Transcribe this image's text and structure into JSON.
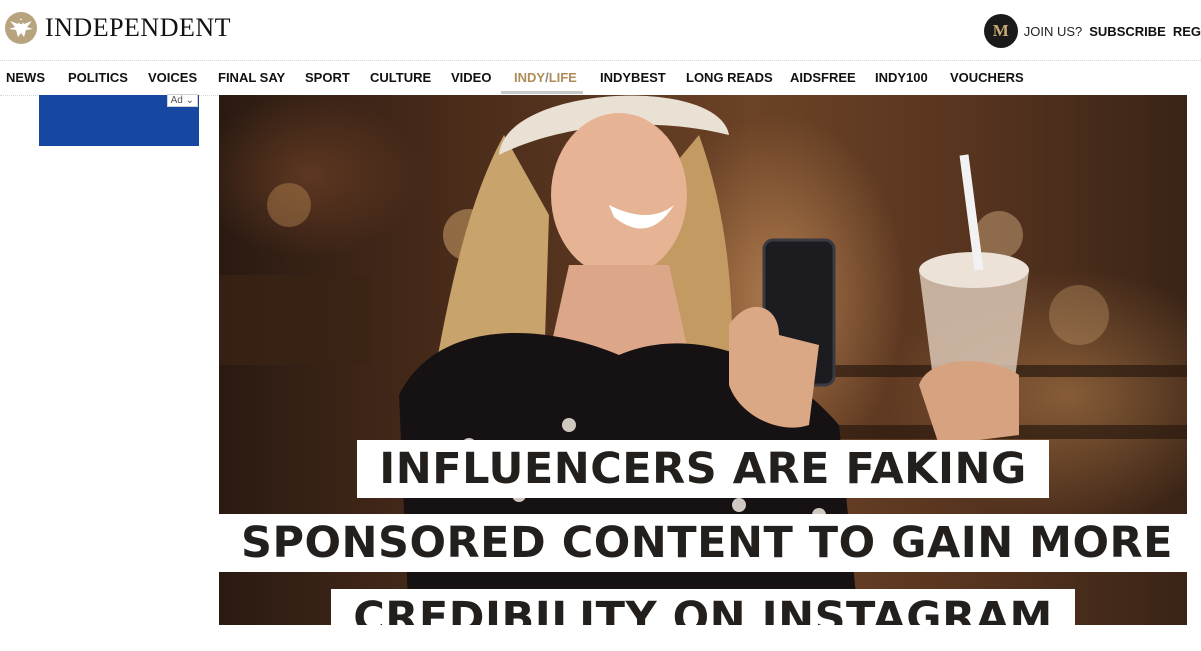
{
  "brand": {
    "name": "INDEPENDENT",
    "eagle_icon": "eagle-icon"
  },
  "account": {
    "badge": "M",
    "join_label": "JOIN US?",
    "subscribe_label": "SUBSCRIBE",
    "register_label": "REG"
  },
  "nav": {
    "items": [
      "NEWS",
      "POLITICS",
      "VOICES",
      "FINAL SAY",
      "SPORT",
      "CULTURE",
      "VIDEO",
      "INDY",
      "INDYBEST",
      "LONG READS",
      "AIDSFREE",
      "INDY100",
      "VOUCHERS"
    ],
    "active_prefix": "INDY",
    "active_suffix": "LIFE",
    "active_color": "#b08d57"
  },
  "ad": {
    "label": "Ad",
    "chevron_icon": "chevron-down-icon",
    "color": "#1847a2"
  },
  "hero": {
    "headline_lines": [
      "INFLUENCERS ARE FAKING",
      "SPONSORED CONTENT TO GAIN MORE",
      "CREDIBILITY ON INSTAGRAM"
    ]
  }
}
